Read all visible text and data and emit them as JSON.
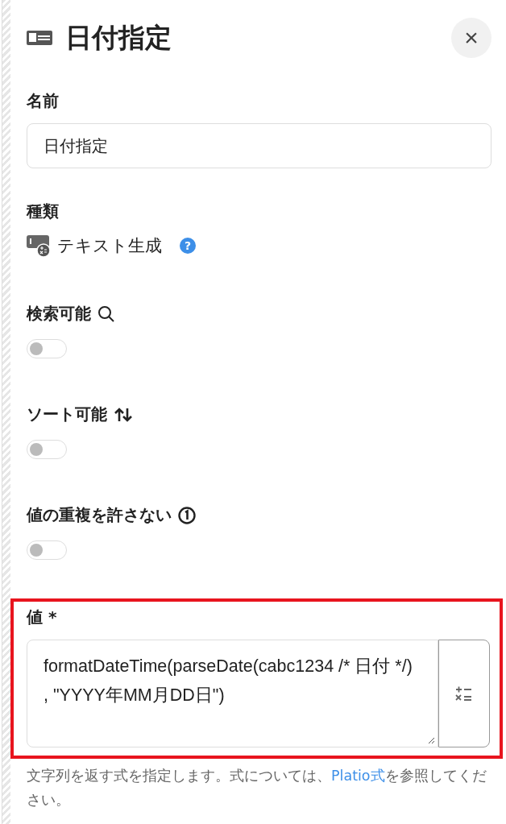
{
  "panel": {
    "title": "日付指定",
    "close": "×"
  },
  "name_field": {
    "label": "名前",
    "value": "日付指定"
  },
  "type_field": {
    "label": "種類",
    "value": "テキスト生成",
    "help": "?"
  },
  "toggles": [
    {
      "kind": "searchable",
      "label": "検索可能",
      "on": false
    },
    {
      "kind": "sortable",
      "label": "ソート可能",
      "on": false
    },
    {
      "kind": "unique",
      "label": "値の重複を許さない",
      "on": false
    }
  ],
  "value_field": {
    "label": "値 *",
    "value": "formatDateTime(parseDate(cabc1234 /* 日付 */) , \"YYYY年MM月DD日\")",
    "highlighted": true
  },
  "help": {
    "before": "文字列を返す式を指定します。式については、",
    "link": "Platio式",
    "after": "を参照してください。"
  }
}
